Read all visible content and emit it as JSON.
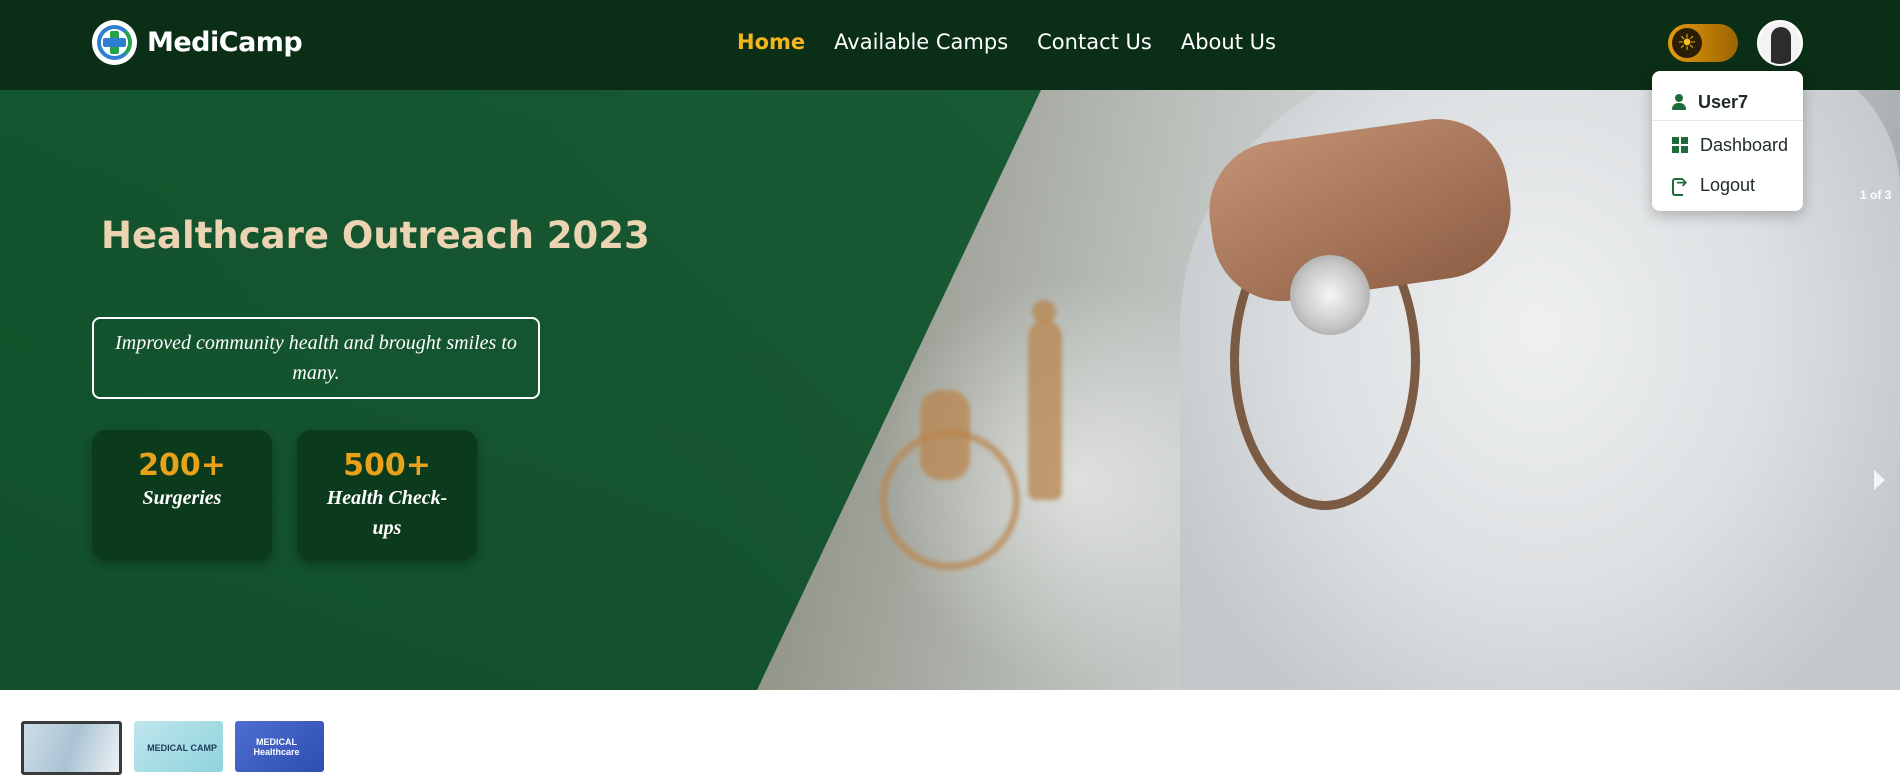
{
  "brand": {
    "name": "MediCamp"
  },
  "nav": {
    "items": [
      {
        "label": "Home",
        "active": true
      },
      {
        "label": "Available Camps",
        "active": false
      },
      {
        "label": "Contact Us",
        "active": false
      },
      {
        "label": "About Us",
        "active": false
      }
    ]
  },
  "theme_toggle": {
    "icon": "sun-icon"
  },
  "user_menu": {
    "username": "User7",
    "items": [
      {
        "label": "Dashboard",
        "icon": "dashboard-icon"
      },
      {
        "label": "Logout",
        "icon": "logout-icon"
      }
    ]
  },
  "hero": {
    "slide_counter": "1 of 3",
    "title": "Healthcare Outreach 2023",
    "quote": "Improved community health and brought smiles to many.",
    "stats": [
      {
        "value": "200+",
        "label": "Surgeries"
      },
      {
        "value": "500+",
        "label": "Health Check-ups"
      }
    ],
    "slides_total": 3,
    "active_slide": 1
  },
  "thumbnails": [
    {
      "caption": ""
    },
    {
      "caption": "MEDICAL CAMP"
    },
    {
      "caption": "MEDICAL Healthcare"
    }
  ],
  "colors": {
    "nav_bg": "#0b2e17",
    "accent_active": "#f2b51f",
    "hero_green": "#0e542d",
    "stat_number": "#e8a21a",
    "title_text": "#ecd4b2"
  }
}
